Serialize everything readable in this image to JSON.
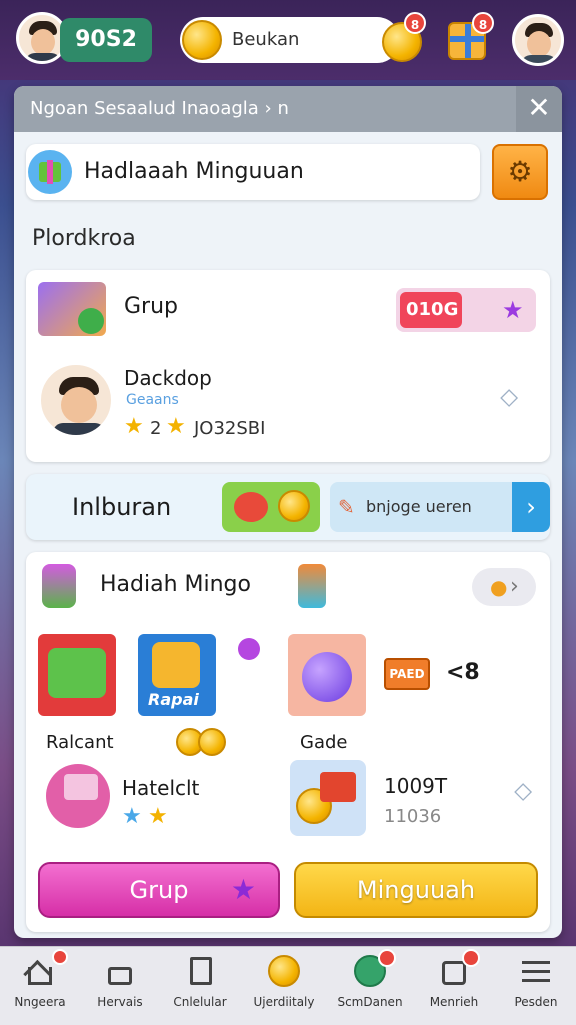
{
  "topbar": {
    "score": "90S2",
    "coin_label": "Beukan",
    "coin_badge": "8",
    "gift_badge": "8"
  },
  "panel": {
    "header_title": "Ngoan Sesaalud Inaoagla  › n",
    "close_label": "✕",
    "weekly_title": "Hadlaaah Minguuan",
    "section_label": "Plordkroa",
    "group": {
      "title": "Grup",
      "badge_text": "010G",
      "profile_name": "Dackdop",
      "profile_sub": "Geaans",
      "rating_text": "2",
      "id_text": "JO32SBI"
    },
    "entertain": {
      "label": "Inlburan",
      "search_text": "bnjoge ueren"
    },
    "rewards": {
      "title": "Hadiah Mingo",
      "items": [
        {
          "label": "Ralcant"
        },
        {
          "label": "Rapai"
        },
        {
          "label": "Gade"
        },
        {
          "label": "PAED"
        },
        {
          "label": "<8"
        }
      ],
      "row2_name": "Hatelclt",
      "row2_value": "1009T",
      "row2_sub": "11036"
    },
    "buttons": {
      "group_label": "Grup",
      "weekly_label": "Minguuah"
    }
  },
  "nav": [
    {
      "label": "Nngeera",
      "icon": "home-icon"
    },
    {
      "label": "Hervais",
      "icon": "house-icon"
    },
    {
      "label": "Cnlelular",
      "icon": "book-icon"
    },
    {
      "label": "Ujerdiitaly",
      "icon": "coin-icon"
    },
    {
      "label": "ScmDanen",
      "icon": "globe-icon"
    },
    {
      "label": "Menrieh",
      "icon": "puzzle-icon"
    },
    {
      "label": "Pesden",
      "icon": "menu-icon"
    }
  ]
}
